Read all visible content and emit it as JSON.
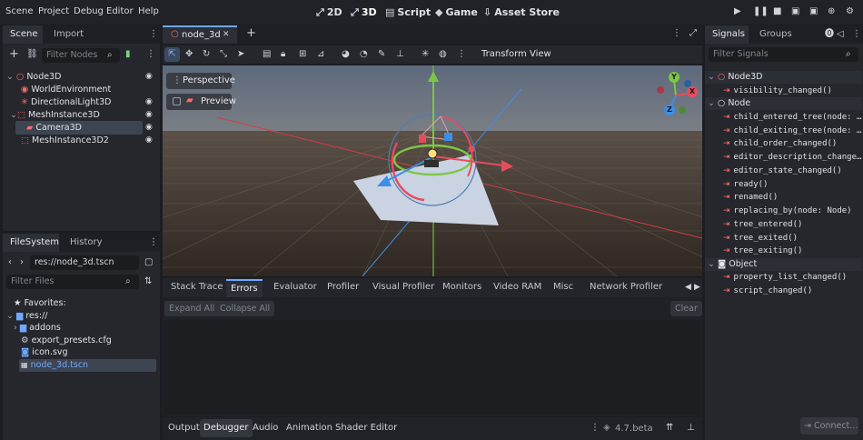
{
  "menu": [
    "Scene",
    "Project",
    "Debug",
    "Editor",
    "Help"
  ],
  "workspaces": [
    {
      "label": "2D",
      "glyph": "⤢"
    },
    {
      "label": "3D",
      "glyph": "⤢"
    },
    {
      "label": "Script",
      "glyph": "▤"
    },
    {
      "label": "Game",
      "glyph": "◆"
    },
    {
      "label": "Asset Store",
      "glyph": "⇩"
    }
  ],
  "scene_dock": {
    "tabs": [
      "Scene",
      "Import"
    ],
    "filter_placeholder": "Filter Nodes",
    "nodes": [
      {
        "label": "Node3D",
        "icon": "○",
        "color": "#ff6b6b"
      },
      {
        "label": "WorldEnvironment",
        "icon": "◉",
        "color": "#ff6b6b"
      },
      {
        "label": "DirectionalLight3D",
        "icon": "✳",
        "color": "#ff6b6b"
      },
      {
        "label": "MeshInstance3D",
        "icon": "⬚",
        "color": "#ff6b6b"
      },
      {
        "label": "Camera3D",
        "icon": "▰",
        "color": "#ff6b6b"
      },
      {
        "label": "MeshInstance3D2",
        "icon": "⬚",
        "color": "#ff6b6b"
      }
    ]
  },
  "filesystem": {
    "tabs": [
      "FileSystem",
      "History"
    ],
    "path": "res://node_3d.tscn",
    "filter_placeholder": "Filter Files",
    "items": [
      {
        "label": "Favorites:",
        "icon": "★"
      },
      {
        "label": "res://",
        "icon": "▆"
      },
      {
        "label": "addons",
        "icon": "▆"
      },
      {
        "label": "export_presets.cfg",
        "icon": "⚙"
      },
      {
        "label": "icon.svg",
        "icon": "◙"
      },
      {
        "label": "node_3d.tscn",
        "icon": "🎬"
      }
    ]
  },
  "editor_tab": {
    "label": "node_3d",
    "close": "✕",
    "add": "+"
  },
  "viewport": {
    "perspective_label": "Perspective",
    "preview_label": "Preview",
    "toolbar_menus": [
      "Transform",
      "View"
    ],
    "gizmo": {
      "y": "Y",
      "x": "X",
      "z": "Z"
    }
  },
  "debugger": {
    "tabs": [
      "Stack Trace",
      "Errors",
      "Evaluator",
      "Profiler",
      "Visual Profiler",
      "Monitors",
      "Video RAM",
      "Misc",
      "Network Profiler"
    ],
    "active_tab": "Errors",
    "expand_all": "Expand All",
    "collapse_all": "Collapse All",
    "clear": "Clear"
  },
  "bottom_panel": {
    "tabs": [
      "Output",
      "Debugger",
      "Audio",
      "Animation",
      "Shader Editor"
    ],
    "active_tab": "Debugger",
    "version": "4.7.beta"
  },
  "signals_dock": {
    "tabs": [
      "Signals",
      "Groups"
    ],
    "filter_placeholder": "Filter Signals",
    "connect_label": "Connect...",
    "sections": [
      {
        "title": "Node3D",
        "signals": [
          "visibility_changed()"
        ]
      },
      {
        "title": "Node",
        "signals": [
          "child_entered_tree(node: …",
          "child_exiting_tree(node: …",
          "child_order_changed()",
          "editor_description_change…",
          "editor_state_changed()",
          "ready()",
          "renamed()",
          "replacing_by(node: Node)",
          "tree_entered()",
          "tree_exited()",
          "tree_exiting()"
        ]
      },
      {
        "title": "Object",
        "signals": [
          "property_list_changed()",
          "script_changed()"
        ]
      }
    ]
  },
  "colors": {
    "accent": "#6fa8ff",
    "signal": "#ff6b6b",
    "x_axis": "#e74c5c",
    "y_axis": "#7cc643",
    "z_axis": "#3d8ee8"
  }
}
